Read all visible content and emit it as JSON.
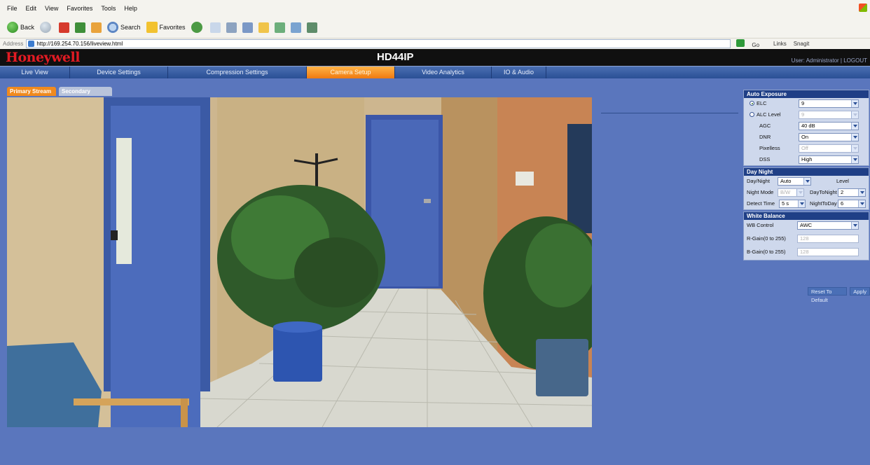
{
  "browser": {
    "menu": [
      "File",
      "Edit",
      "View",
      "Favorites",
      "Tools",
      "Help"
    ],
    "toolbar": {
      "back_label": "Back",
      "search_label": "Search",
      "favorites_label": "Favorites"
    },
    "address_label": "Address",
    "url": "http://169.254.70.156/liveview.html",
    "go_label": "Go",
    "links_label": "Links",
    "snagit_label": "Snagit"
  },
  "app": {
    "logo": "Honeywell",
    "model": "HD44IP",
    "user": "User: Administrator | LOGOUT"
  },
  "nav": {
    "tabs": [
      "Live View",
      "Device Settings",
      "Compression Settings",
      "Camera Setup",
      "Video Analytics",
      "IO & Audio"
    ],
    "active_tab": "Camera Setup"
  },
  "streams": {
    "primary": "Primary Stream",
    "secondary": "Secondary Stream",
    "active": "Primary Stream"
  },
  "auto_exposure": {
    "title": "Auto Exposure",
    "elc_label": "ELC",
    "elc_value": "9",
    "alc_label": "ALC Level",
    "alc_value": "9",
    "agc_label": "AGC",
    "agc_value": "40 dB",
    "dnr_label": "DNR",
    "dnr_value": "On",
    "pixelless_label": "Pixelless",
    "pixelless_value": "Off",
    "dss_label": "DSS",
    "dss_value": "High",
    "selected_mode": "ELC"
  },
  "day_night": {
    "title": "Day Night",
    "mode_label": "Day/Night",
    "mode_value": "Auto",
    "level_label": "Level",
    "night_mode_label": "Night Mode",
    "night_mode_value": "B/W",
    "day_to_night_label": "DayToNight",
    "day_to_night_value": "2",
    "detect_time_label": "Detect Time",
    "detect_time_value": "5 s",
    "night_to_day_label": "NightToDay",
    "night_to_day_value": "6"
  },
  "white_balance": {
    "title": "White Balance",
    "wb_label": "WB Control",
    "wb_value": "AWC",
    "rgain_label": "R-Gain(0 to 255)",
    "rgain_value": "128",
    "bgain_label": "B-Gain(0 to 255)",
    "bgain_value": "128"
  },
  "actions": {
    "reset_label": "Reset To Default",
    "apply_label": "Apply"
  },
  "colors": {
    "page_bg": "#5a76bd",
    "nav_active": "#f07a10",
    "brand": "#e31b23",
    "section_header": "#1f3f86"
  }
}
